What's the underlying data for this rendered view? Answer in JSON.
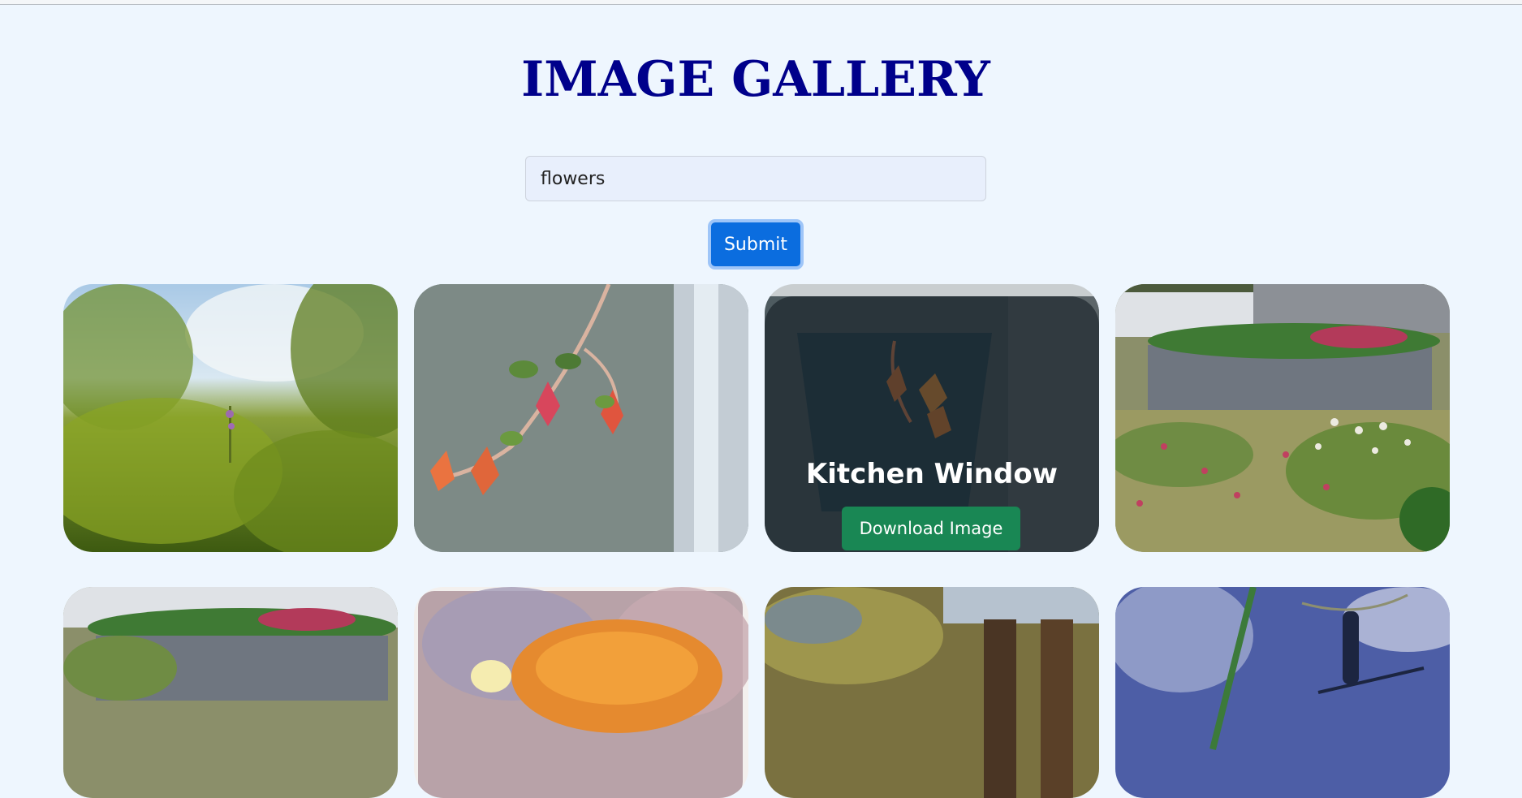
{
  "page": {
    "title": "IMAGE GALLERY"
  },
  "search": {
    "value": "flowers",
    "placeholder": ""
  },
  "submit_label": "Submit",
  "hovered_card": {
    "title": "Kitchen Window",
    "download_label": "Download Image"
  },
  "colors": {
    "background": "#eef6fe",
    "title": "#00008b",
    "submit": "#0b6ddf",
    "download": "#198754"
  }
}
